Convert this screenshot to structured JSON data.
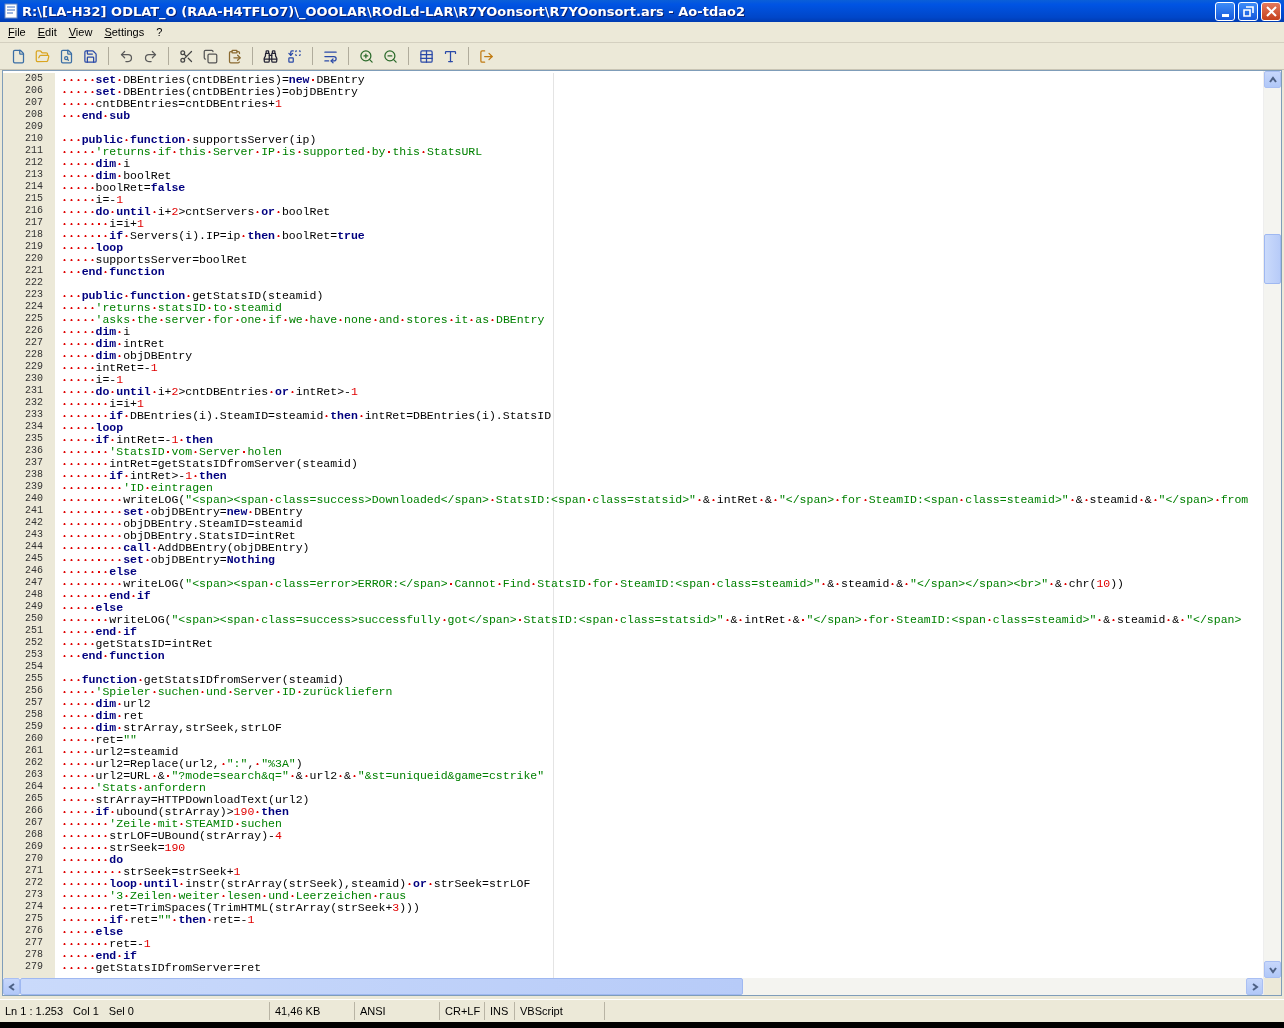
{
  "window": {
    "title": "R:\\[LA-H32] ODLAT_O (RAA-H4TFLO7)\\_OOOLAR\\ROdLd-LAR\\R7YOonsort\\R7YOonsort.ars - Ao-tdao2"
  },
  "menu": [
    "File",
    "Edit",
    "View",
    "Settings",
    "?"
  ],
  "editor": {
    "lines": [
      {
        "number": "205",
        "parts": [
          {
            "kind": "keyword",
            "text": "     set"
          },
          {
            "kind": "plain",
            "text": " DBEntries(cntDBEntries)="
          },
          {
            "kind": "keyword",
            "text": "new"
          },
          {
            "kind": "plain",
            "text": " DBEntry"
          }
        ]
      },
      {
        "number": "206",
        "parts": [
          {
            "kind": "keyword",
            "text": "     set"
          },
          {
            "kind": "plain",
            "text": " DBEntries(cntDBEntries)=objDBEntry"
          }
        ]
      },
      {
        "number": "207",
        "parts": [
          {
            "kind": "plain",
            "text": "     cntDBEntries=cntDBEntries+"
          },
          {
            "kind": "number",
            "text": "1"
          }
        ]
      },
      {
        "number": "208",
        "parts": [
          {
            "kind": "keyword",
            "text": "   end sub"
          }
        ]
      },
      {
        "number": "209"
      },
      {
        "number": "210",
        "parts": [
          {
            "kind": "keyword",
            "text": "   public function"
          },
          {
            "kind": "plain",
            "text": " supportsServer(ip)"
          }
        ]
      },
      {
        "number": "211",
        "parts": [
          {
            "kind": "comment",
            "text": "     'returns if this Server IP is supported by this StatsURL"
          }
        ]
      },
      {
        "number": "212",
        "parts": [
          {
            "kind": "keyword",
            "text": "     dim"
          },
          {
            "kind": "plain",
            "text": " i"
          }
        ]
      },
      {
        "number": "213",
        "parts": [
          {
            "kind": "keyword",
            "text": "     dim"
          },
          {
            "kind": "plain",
            "text": " boolRet"
          }
        ]
      },
      {
        "number": "214",
        "parts": [
          {
            "kind": "plain",
            "text": "     boolRet="
          },
          {
            "kind": "keyword",
            "text": "false"
          }
        ]
      },
      {
        "number": "215",
        "parts": [
          {
            "kind": "plain",
            "text": "     i=-"
          },
          {
            "kind": "number",
            "text": "1"
          }
        ]
      },
      {
        "number": "216",
        "parts": [
          {
            "kind": "keyword",
            "text": "     do until"
          },
          {
            "kind": "plain",
            "text": " i+"
          },
          {
            "kind": "number",
            "text": "2"
          },
          {
            "kind": "plain",
            "text": ">cntServers "
          },
          {
            "kind": "keyword",
            "text": "or"
          },
          {
            "kind": "plain",
            "text": " boolRet"
          }
        ]
      },
      {
        "number": "217",
        "parts": [
          {
            "kind": "plain",
            "text": "       i=i+"
          },
          {
            "kind": "number",
            "text": "1"
          }
        ]
      },
      {
        "number": "218",
        "parts": [
          {
            "kind": "keyword",
            "text": "       if"
          },
          {
            "kind": "plain",
            "text": " Servers(i).IP=ip "
          },
          {
            "kind": "keyword",
            "text": "then"
          },
          {
            "kind": "plain",
            "text": " boolRet="
          },
          {
            "kind": "keyword",
            "text": "true"
          }
        ]
      },
      {
        "number": "219",
        "parts": [
          {
            "kind": "keyword",
            "text": "     loop"
          }
        ]
      },
      {
        "number": "220",
        "parts": [
          {
            "kind": "plain",
            "text": "     supportsServer=boolRet"
          }
        ]
      },
      {
        "number": "221",
        "parts": [
          {
            "kind": "keyword",
            "text": "   end function"
          }
        ]
      },
      {
        "number": "222"
      },
      {
        "number": "223",
        "parts": [
          {
            "kind": "keyword",
            "text": "   public function"
          },
          {
            "kind": "plain",
            "text": " getStatsID(steamid)"
          }
        ]
      },
      {
        "number": "224",
        "parts": [
          {
            "kind": "comment",
            "text": "     'returns statsID to steamid"
          }
        ]
      },
      {
        "number": "225",
        "parts": [
          {
            "kind": "comment",
            "text": "     'asks the server for one if we have none and stores it as DBEntry"
          }
        ]
      },
      {
        "number": "226",
        "parts": [
          {
            "kind": "keyword",
            "text": "     dim"
          },
          {
            "kind": "plain",
            "text": " i"
          }
        ]
      },
      {
        "number": "227",
        "parts": [
          {
            "kind": "keyword",
            "text": "     dim"
          },
          {
            "kind": "plain",
            "text": " intRet"
          }
        ]
      },
      {
        "number": "228",
        "parts": [
          {
            "kind": "keyword",
            "text": "     dim"
          },
          {
            "kind": "plain",
            "text": " objDBEntry"
          }
        ]
      },
      {
        "number": "229",
        "parts": [
          {
            "kind": "plain",
            "text": "     intRet=-"
          },
          {
            "kind": "number",
            "text": "1"
          }
        ]
      },
      {
        "number": "230",
        "parts": [
          {
            "kind": "plain",
            "text": "     i=-"
          },
          {
            "kind": "number",
            "text": "1"
          }
        ]
      },
      {
        "number": "231",
        "parts": [
          {
            "kind": "keyword",
            "text": "     do until"
          },
          {
            "kind": "plain",
            "text": " i+"
          },
          {
            "kind": "number",
            "text": "2"
          },
          {
            "kind": "plain",
            "text": ">cntDBEntries "
          },
          {
            "kind": "keyword",
            "text": "or"
          },
          {
            "kind": "plain",
            "text": " intRet>-"
          },
          {
            "kind": "number",
            "text": "1"
          }
        ]
      },
      {
        "number": "232",
        "parts": [
          {
            "kind": "plain",
            "text": "       i=i+"
          },
          {
            "kind": "number",
            "text": "1"
          }
        ]
      },
      {
        "number": "233",
        "parts": [
          {
            "kind": "keyword",
            "text": "       if"
          },
          {
            "kind": "plain",
            "text": " DBEntries(i).SteamID=steamid "
          },
          {
            "kind": "keyword",
            "text": "then"
          },
          {
            "kind": "plain",
            "text": " intRet=DBEntries(i).StatsID"
          }
        ]
      },
      {
        "number": "234",
        "parts": [
          {
            "kind": "keyword",
            "text": "     loop"
          }
        ]
      },
      {
        "number": "235",
        "parts": [
          {
            "kind": "keyword",
            "text": "     if"
          },
          {
            "kind": "plain",
            "text": " intRet=-"
          },
          {
            "kind": "number",
            "text": "1"
          },
          {
            "kind": "keyword",
            "text": " then"
          }
        ]
      },
      {
        "number": "236",
        "parts": [
          {
            "kind": "comment",
            "text": "       'StatsID vom Server holen"
          }
        ]
      },
      {
        "number": "237",
        "parts": [
          {
            "kind": "plain",
            "text": "       intRet=getStatsIDfromServer(steamid)"
          }
        ]
      },
      {
        "number": "238",
        "parts": [
          {
            "kind": "keyword",
            "text": "       if"
          },
          {
            "kind": "plain",
            "text": " intRet>-"
          },
          {
            "kind": "number",
            "text": "1"
          },
          {
            "kind": "keyword",
            "text": " then"
          }
        ]
      },
      {
        "number": "239",
        "parts": [
          {
            "kind": "comment",
            "text": "         'ID eintragen"
          }
        ]
      },
      {
        "number": "240",
        "parts": [
          {
            "kind": "plain",
            "text": "         writeLOG("
          },
          {
            "kind": "string",
            "text": "\"<span><span class=success>Downloaded</span> StatsID:<span class=statsid>\""
          },
          {
            "kind": "plain",
            "text": " & intRet & "
          },
          {
            "kind": "string",
            "text": "\"</span> for SteamID:<span class=steamid>\""
          },
          {
            "kind": "plain",
            "text": " & steamid & "
          },
          {
            "kind": "string",
            "text": "\"</span> from"
          }
        ]
      },
      {
        "number": "241",
        "parts": [
          {
            "kind": "keyword",
            "text": "         set"
          },
          {
            "kind": "plain",
            "text": " objDBEntry="
          },
          {
            "kind": "keyword",
            "text": "new"
          },
          {
            "kind": "plain",
            "text": " DBEntry"
          }
        ]
      },
      {
        "number": "242",
        "parts": [
          {
            "kind": "plain",
            "text": "         objDBEntry.SteamID=steamid"
          }
        ]
      },
      {
        "number": "243",
        "parts": [
          {
            "kind": "plain",
            "text": "         objDBEntry.StatsID=intRet"
          }
        ]
      },
      {
        "number": "244",
        "parts": [
          {
            "kind": "keyword",
            "text": "         call"
          },
          {
            "kind": "plain",
            "text": " AddDBEntry(objDBEntry)"
          }
        ]
      },
      {
        "number": "245",
        "parts": [
          {
            "kind": "keyword",
            "text": "         set"
          },
          {
            "kind": "plain",
            "text": " objDBEntry="
          },
          {
            "kind": "keyword",
            "text": "Nothing"
          }
        ]
      },
      {
        "number": "246",
        "parts": [
          {
            "kind": "keyword",
            "text": "       else"
          }
        ]
      },
      {
        "number": "247",
        "parts": [
          {
            "kind": "plain",
            "text": "         writeLOG("
          },
          {
            "kind": "string",
            "text": "\"<span><span class=error>ERROR:</span> Cannot Find StatsID for SteamID:<span class=steamid>\""
          },
          {
            "kind": "plain",
            "text": " & steamid & "
          },
          {
            "kind": "string",
            "text": "\"</span></span><br>\""
          },
          {
            "kind": "plain",
            "text": " & chr("
          },
          {
            "kind": "number",
            "text": "10"
          },
          {
            "kind": "plain",
            "text": "))"
          }
        ]
      },
      {
        "number": "248",
        "parts": [
          {
            "kind": "keyword",
            "text": "       end if"
          }
        ]
      },
      {
        "number": "249",
        "parts": [
          {
            "kind": "keyword",
            "text": "     else"
          }
        ]
      },
      {
        "number": "250",
        "parts": [
          {
            "kind": "plain",
            "text": "       writeLOG("
          },
          {
            "kind": "string",
            "text": "\"<span><span class=success>successfully got</span> StatsID:<span class=statsid>\""
          },
          {
            "kind": "plain",
            "text": " & intRet & "
          },
          {
            "kind": "string",
            "text": "\"</span> for SteamID:<span class=steamid>\""
          },
          {
            "kind": "plain",
            "text": " & steamid & "
          },
          {
            "kind": "string",
            "text": "\"</span>"
          }
        ]
      },
      {
        "number": "251",
        "parts": [
          {
            "kind": "keyword",
            "text": "     end if"
          }
        ]
      },
      {
        "number": "252",
        "parts": [
          {
            "kind": "plain",
            "text": "     getStatsID=intRet"
          }
        ]
      },
      {
        "number": "253",
        "parts": [
          {
            "kind": "keyword",
            "text": "   end function"
          }
        ]
      },
      {
        "number": "254"
      },
      {
        "number": "255",
        "parts": [
          {
            "kind": "keyword",
            "text": "   function"
          },
          {
            "kind": "plain",
            "text": " getStatsIDfromServer(steamid)"
          }
        ]
      },
      {
        "number": "256",
        "parts": [
          {
            "kind": "comment",
            "text": "     'Spieler suchen und Server ID zurückliefern"
          }
        ]
      },
      {
        "number": "257",
        "parts": [
          {
            "kind": "keyword",
            "text": "     dim"
          },
          {
            "kind": "plain",
            "text": " url2"
          }
        ]
      },
      {
        "number": "258",
        "parts": [
          {
            "kind": "keyword",
            "text": "     dim"
          },
          {
            "kind": "plain",
            "text": " ret"
          }
        ]
      },
      {
        "number": "259",
        "parts": [
          {
            "kind": "keyword",
            "text": "     dim"
          },
          {
            "kind": "plain",
            "text": " strArray,strSeek,strLOF"
          }
        ]
      },
      {
        "number": "260",
        "parts": [
          {
            "kind": "plain",
            "text": "     ret="
          },
          {
            "kind": "string",
            "text": "\"\""
          }
        ]
      },
      {
        "number": "261",
        "parts": [
          {
            "kind": "plain",
            "text": "     url2=steamid"
          }
        ]
      },
      {
        "number": "262",
        "parts": [
          {
            "kind": "plain",
            "text": "     url2=Replace(url2, "
          },
          {
            "kind": "string",
            "text": "\":\""
          },
          {
            "kind": "plain",
            "text": ", "
          },
          {
            "kind": "string",
            "text": "\"%3A\""
          },
          {
            "kind": "plain",
            "text": ")"
          }
        ]
      },
      {
        "number": "263",
        "parts": [
          {
            "kind": "plain",
            "text": "     url2=URL & "
          },
          {
            "kind": "string",
            "text": "\"?mode=search&q=\""
          },
          {
            "kind": "plain",
            "text": " & url2 & "
          },
          {
            "kind": "string",
            "text": "\"&st=uniqueid&game=cstrike\""
          }
        ]
      },
      {
        "number": "264",
        "parts": [
          {
            "kind": "comment",
            "text": "     'Stats anfordern"
          }
        ]
      },
      {
        "number": "265",
        "parts": [
          {
            "kind": "plain",
            "text": "     strArray=HTTPDownloadText(url2)"
          }
        ]
      },
      {
        "number": "266",
        "parts": [
          {
            "kind": "keyword",
            "text": "     if"
          },
          {
            "kind": "plain",
            "text": " ubound(strArray)>"
          },
          {
            "kind": "number",
            "text": "190"
          },
          {
            "kind": "keyword",
            "text": " then"
          }
        ]
      },
      {
        "number": "267",
        "parts": [
          {
            "kind": "comment",
            "text": "       'Zeile mit STEAMID suchen"
          }
        ]
      },
      {
        "number": "268",
        "parts": [
          {
            "kind": "plain",
            "text": "       strLOF=UBound(strArray)-"
          },
          {
            "kind": "number",
            "text": "4"
          }
        ]
      },
      {
        "number": "269",
        "parts": [
          {
            "kind": "plain",
            "text": "       strSeek="
          },
          {
            "kind": "number",
            "text": "190"
          }
        ]
      },
      {
        "number": "270",
        "parts": [
          {
            "kind": "keyword",
            "text": "       do"
          }
        ]
      },
      {
        "number": "271",
        "parts": [
          {
            "kind": "plain",
            "text": "         strSeek=strSeek+"
          },
          {
            "kind": "number",
            "text": "1"
          }
        ]
      },
      {
        "number": "272",
        "parts": [
          {
            "kind": "keyword",
            "text": "       loop until"
          },
          {
            "kind": "plain",
            "text": " instr(strArray(strSeek),steamid) "
          },
          {
            "kind": "keyword",
            "text": "or"
          },
          {
            "kind": "plain",
            "text": " strSeek=strLOF"
          }
        ]
      },
      {
        "number": "273",
        "parts": [
          {
            "kind": "comment",
            "text": "       '3 Zeilen weiter lesen und Leerzeichen raus"
          }
        ]
      },
      {
        "number": "274",
        "parts": [
          {
            "kind": "plain",
            "text": "       ret=TrimSpaces(TrimHTML(strArray(strSeek+"
          },
          {
            "kind": "number",
            "text": "3"
          },
          {
            "kind": "plain",
            "text": ")))"
          }
        ]
      },
      {
        "number": "275",
        "parts": [
          {
            "kind": "keyword",
            "text": "       if"
          },
          {
            "kind": "plain",
            "text": " ret="
          },
          {
            "kind": "string",
            "text": "\"\""
          },
          {
            "kind": "keyword",
            "text": " then"
          },
          {
            "kind": "plain",
            "text": " ret=-"
          },
          {
            "kind": "number",
            "text": "1"
          }
        ]
      },
      {
        "number": "276",
        "parts": [
          {
            "kind": "keyword",
            "text": "     else"
          }
        ]
      },
      {
        "number": "277",
        "parts": [
          {
            "kind": "plain",
            "text": "       ret=-"
          },
          {
            "kind": "number",
            "text": "1"
          }
        ]
      },
      {
        "number": "278",
        "parts": [
          {
            "kind": "keyword",
            "text": "     end if"
          }
        ]
      },
      {
        "number": "279",
        "parts": [
          {
            "kind": "plain",
            "text": "     getStatsIDfromServer=ret"
          }
        ]
      }
    ]
  },
  "status_bar": [
    {
      "items": [
        "Ln 1 : 1.253",
        "Col 1",
        "Sel 0"
      ]
    },
    {
      "items": [
        "41,46 KB"
      ]
    },
    {
      "items": [
        "ANSI"
      ]
    },
    {
      "items": [
        "CR+LF"
      ]
    },
    {
      "items": [
        "INS"
      ]
    },
    {
      "items": [
        "VBScript"
      ]
    }
  ]
}
